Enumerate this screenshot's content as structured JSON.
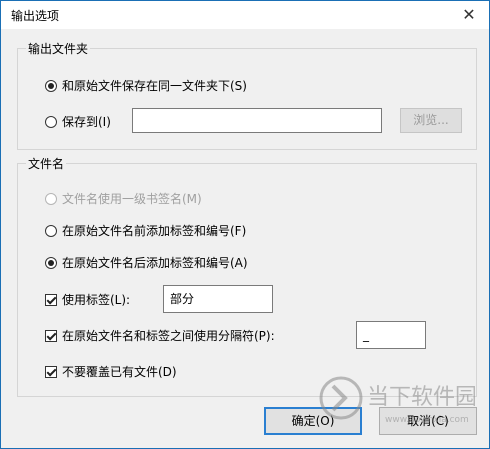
{
  "window": {
    "title": "输出选项",
    "close": "✕"
  },
  "output_folder": {
    "legend": "输出文件夹",
    "same_folder_label": "和原始文件保存在同一文件夹下(S)",
    "save_to_label": "保存到(I)",
    "save_to_value": "",
    "browse_label": "浏览..."
  },
  "filename": {
    "legend": "文件名",
    "opt_bookmark_label": "文件名使用一级书签名(M)",
    "opt_prefix_label": "在原始文件名前添加标签和编号(F)",
    "opt_suffix_label": "在原始文件名后添加标签和编号(A)",
    "use_label_label": "使用标签(L):",
    "use_label_value": "部分",
    "separator_label": "在原始文件名和标签之间使用分隔符(P):",
    "separator_value": "_",
    "no_overwrite_label": "不要覆盖已有文件(D)"
  },
  "buttons": {
    "ok": "确定(O)",
    "cancel": "取消(C)"
  },
  "watermark": {
    "text": "当下软件园",
    "url": "www.downxia.com"
  }
}
